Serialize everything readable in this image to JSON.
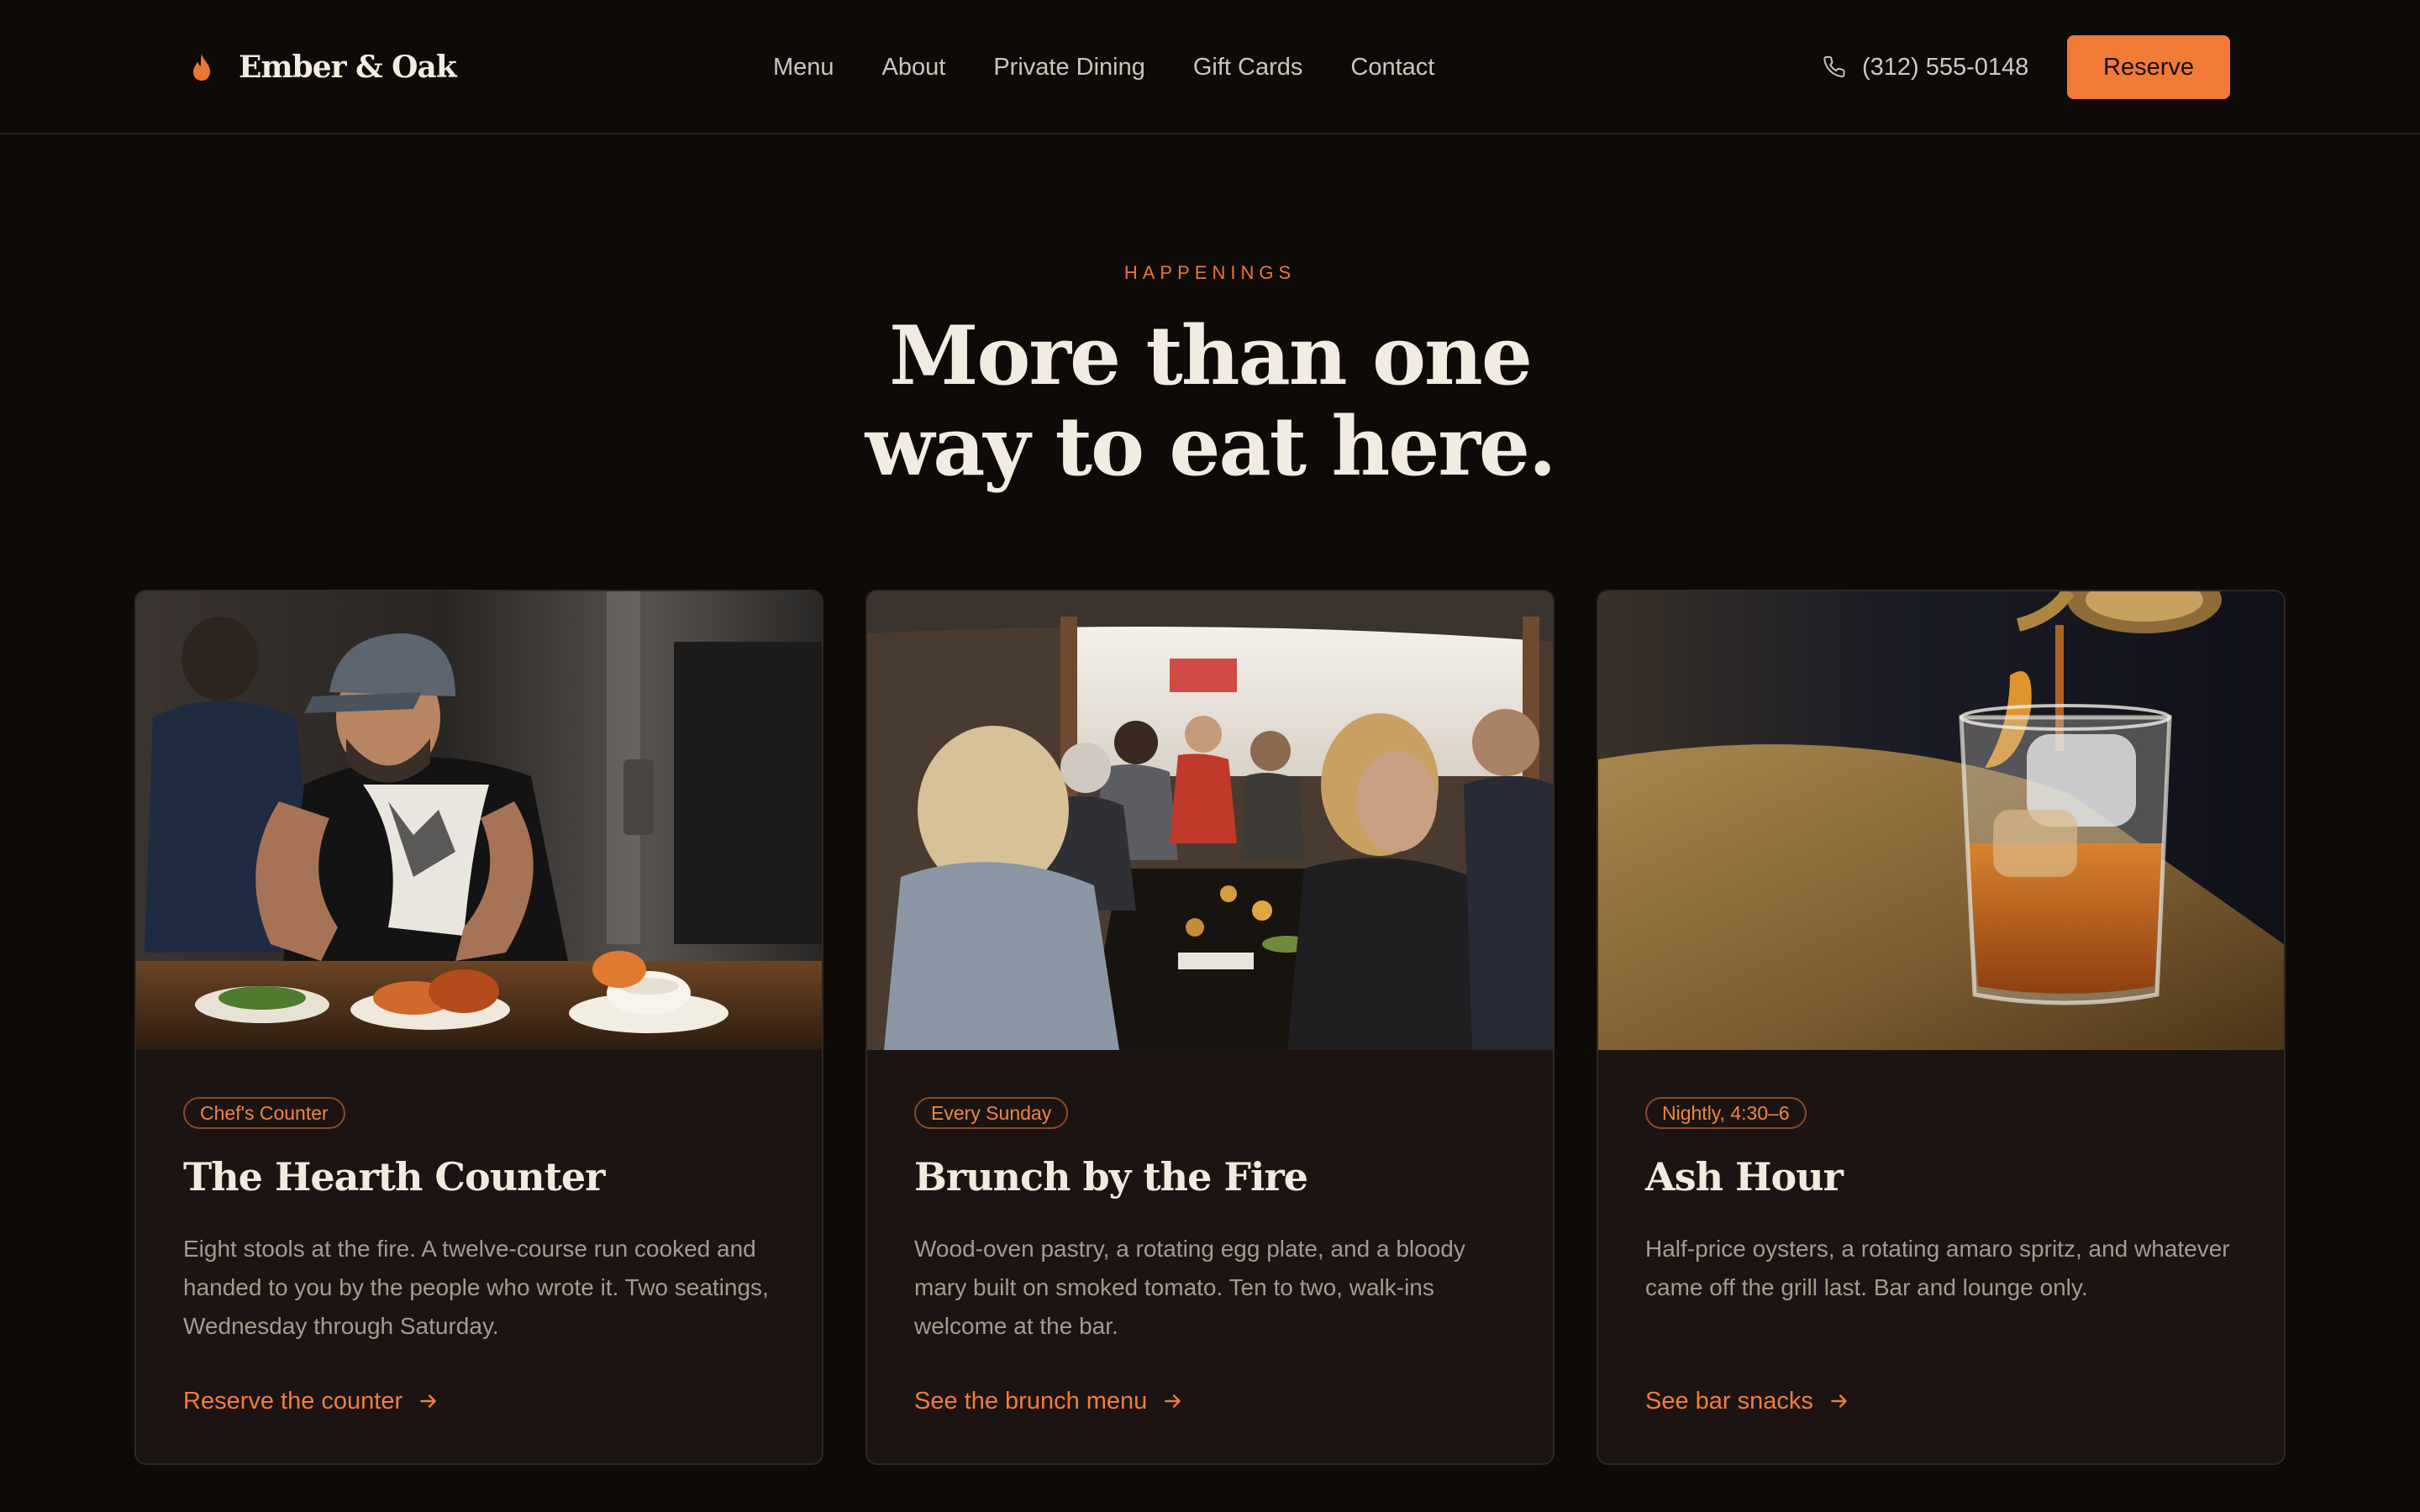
{
  "header": {
    "brand": "Ember & Oak",
    "nav": [
      "Menu",
      "About",
      "Private Dining",
      "Gift Cards",
      "Contact"
    ],
    "phone": "(312) 555-0148",
    "reserve_label": "Reserve"
  },
  "colors": {
    "accent": "#f17a37",
    "background": "#0e0a08",
    "card": "#1b1412"
  },
  "section": {
    "eyebrow": "HAPPENINGS",
    "title_line1": "More than one",
    "title_line2": "way to eat here."
  },
  "cards": [
    {
      "badge": "Chef's Counter",
      "title": "The Hearth Counter",
      "description": "Eight stools at the fire. A twelve-course run cooked and handed to you by the people who wrote it. Two seatings, Wednesday through Saturday.",
      "link": "Reserve the counter",
      "image": "chef-plating-photo"
    },
    {
      "badge": "Every Sunday",
      "title": "Brunch by the Fire",
      "description": "Wood-oven pastry, a rotating egg plate, and a bloody mary built on smoked tomato. Ten to two, walk-ins welcome at the bar.",
      "link": "See the brunch menu",
      "image": "brunch-crowd-photo"
    },
    {
      "badge": "Nightly, 4:30–6",
      "title": "Ash Hour",
      "description": "Half-price oysters, a rotating amaro spritz, and whatever came off the grill last. Bar and lounge only.",
      "link": "See bar snacks",
      "image": "cocktail-pour-photo"
    }
  ],
  "icons": [
    "flame-icon",
    "phone-icon",
    "arrow-right-icon"
  ]
}
